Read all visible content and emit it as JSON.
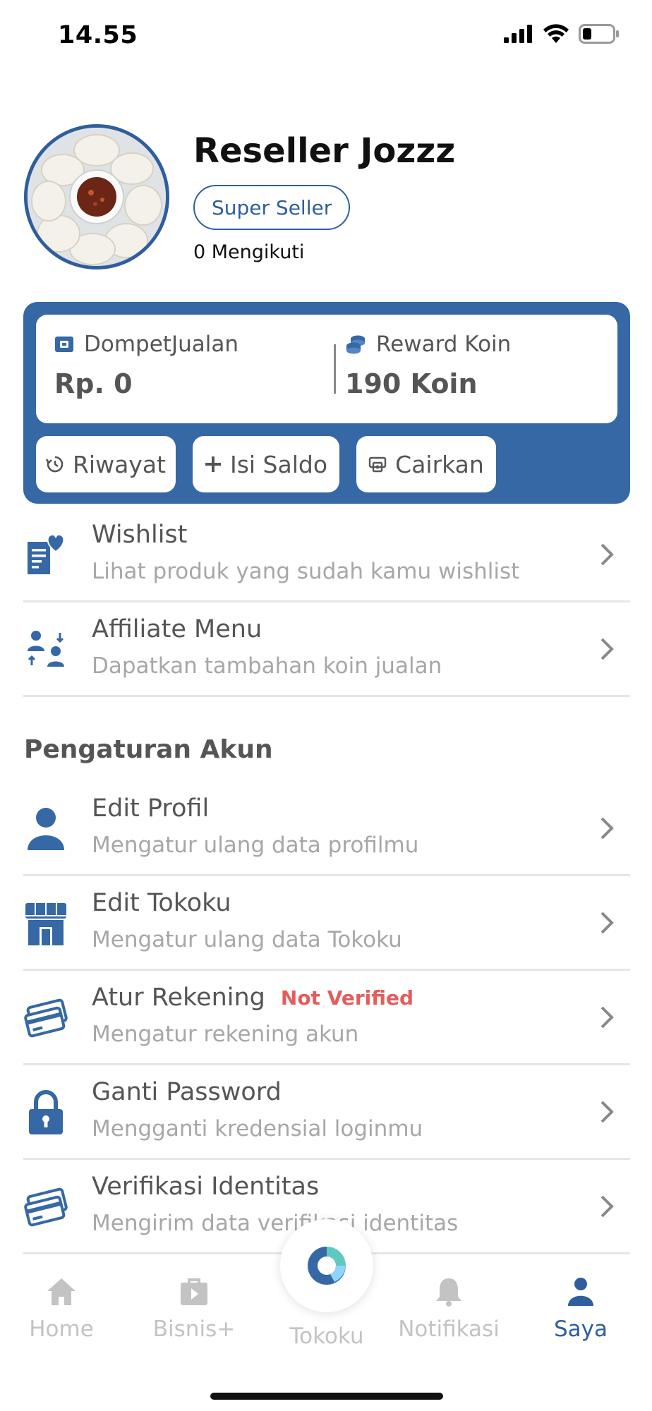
{
  "status": {
    "time": "14.55"
  },
  "profile": {
    "name": "Reseller Jozzz",
    "badge": "Super Seller",
    "following": "0 Mengikuti"
  },
  "wallet": {
    "dompet_label": "DompetJualan",
    "dompet_value": "Rp. 0",
    "koin_label": "Reward Koin",
    "koin_value": "190 Koin",
    "buttons": {
      "riwayat": "Riwayat",
      "isi_saldo": "Isi Saldo",
      "cairkan": "Cairkan"
    }
  },
  "menu": {
    "wishlist": {
      "title": "Wishlist",
      "subtitle": "Lihat produk yang sudah kamu wishlist"
    },
    "affiliate": {
      "title": "Affiliate Menu",
      "subtitle": "Dapatkan tambahan koin jualan"
    }
  },
  "account_settings": {
    "section_title": "Pengaturan Akun",
    "edit_profil": {
      "title": "Edit Profil",
      "subtitle": "Mengatur ulang data profilmu"
    },
    "edit_tokoku": {
      "title": "Edit Tokoku",
      "subtitle": "Mengatur ulang data Tokoku"
    },
    "atur_rekening": {
      "title": "Atur Rekening",
      "badge": "Not Verified",
      "subtitle": "Mengatur rekening akun"
    },
    "ganti_password": {
      "title": "Ganti Password",
      "subtitle": "Mengganti kredensial loginmu"
    },
    "verifikasi": {
      "title": "Verifikasi Identitas",
      "subtitle": "Mengirim data verifikasi identitas"
    }
  },
  "nav": {
    "home": "Home",
    "bisnis": "Bisnis+",
    "tokoku": "Tokoku",
    "notifikasi": "Notifikasi",
    "saya": "Saya"
  },
  "colors": {
    "primary": "#3568a5",
    "muted": "#a7a7a7",
    "warning": "#e35d5d"
  }
}
